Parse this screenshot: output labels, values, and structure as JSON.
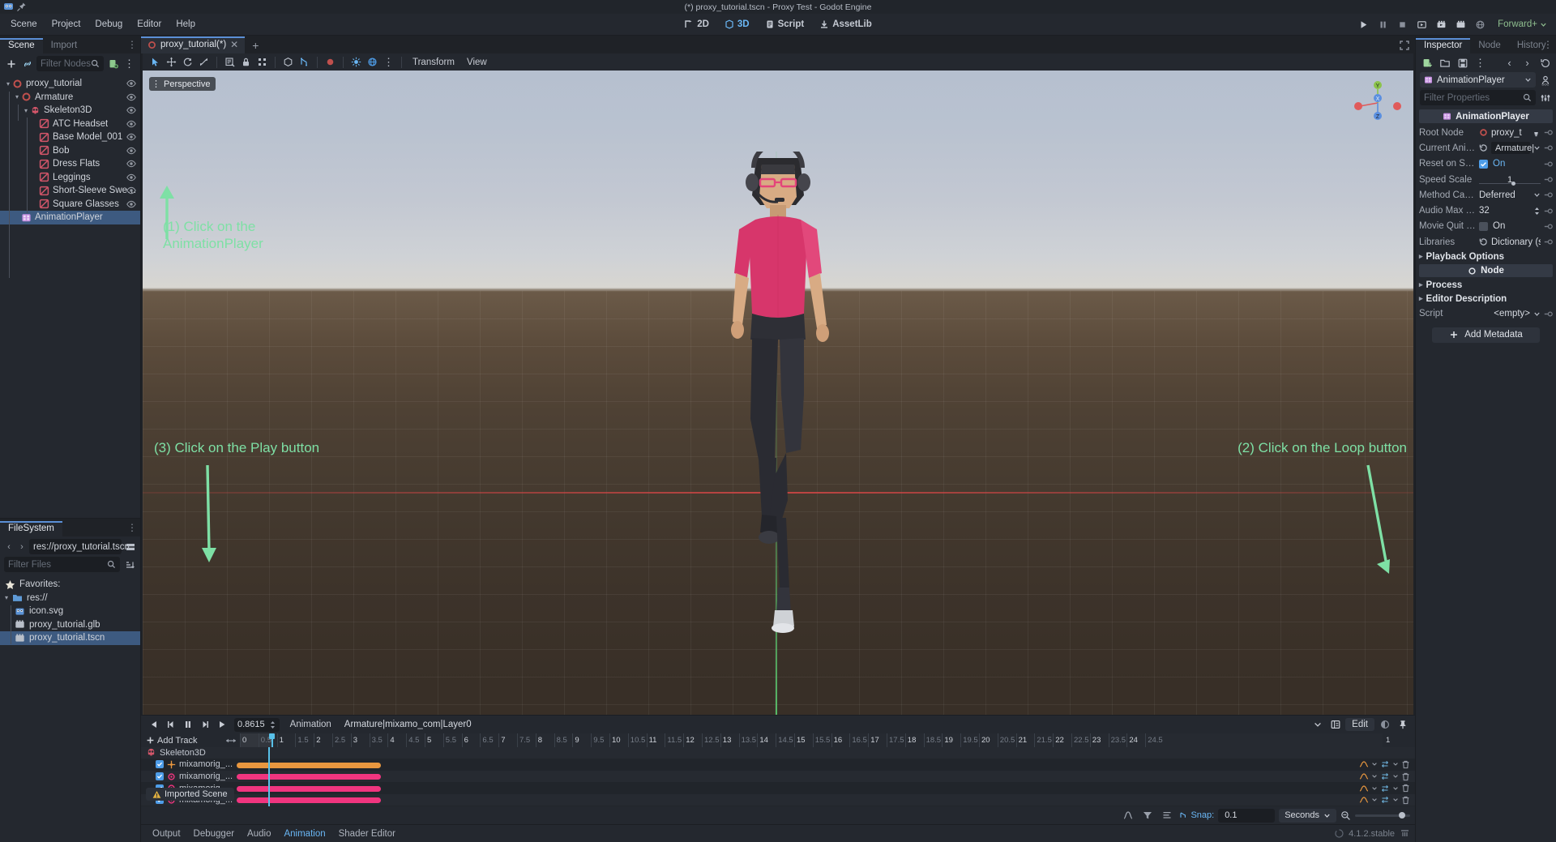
{
  "window": {
    "title": "(*) proxy_tutorial.tscn - Proxy Test - Godot Engine"
  },
  "menubar": {
    "items": [
      "Scene",
      "Project",
      "Debug",
      "Editor",
      "Help"
    ],
    "main_buttons": [
      {
        "label": "2D",
        "icon": "2d-icon",
        "active": false
      },
      {
        "label": "3D",
        "icon": "3d-icon",
        "active": true
      },
      {
        "label": "Script",
        "icon": "script-icon",
        "active": false
      },
      {
        "label": "AssetLib",
        "icon": "assetlib-icon",
        "active": false
      }
    ],
    "run_buttons": [
      "play-icon",
      "pause-icon",
      "stop-icon",
      "play-scene-icon",
      "movie-maker-icon",
      "play-custom-icon",
      "remote-debug-icon"
    ],
    "renderer": "Forward+"
  },
  "scene_panel": {
    "tabs": [
      {
        "label": "Scene",
        "active": true
      },
      {
        "label": "Import",
        "active": false
      }
    ],
    "filter_placeholder": "Filter Nodes",
    "toolbar_icons": [
      "add-node-icon",
      "link-node-icon",
      "search-icon",
      "attach-script-icon",
      "tree-options-icon"
    ],
    "tree": [
      {
        "label": "proxy_tutorial",
        "depth": 0,
        "icon": "node3d-icon",
        "expandable": true,
        "selected": false,
        "visibility": true
      },
      {
        "label": "Armature",
        "depth": 1,
        "icon": "node3d-icon",
        "expandable": true,
        "selected": false,
        "visibility": true
      },
      {
        "label": "Skeleton3D",
        "depth": 2,
        "icon": "skeleton3d-icon",
        "expandable": true,
        "selected": false,
        "visibility": true
      },
      {
        "label": "ATC Headset",
        "depth": 3,
        "icon": "meshinstance3d-icon",
        "expandable": false,
        "selected": false,
        "visibility": true
      },
      {
        "label": "Base Model_001",
        "depth": 3,
        "icon": "meshinstance3d-icon",
        "expandable": false,
        "selected": false,
        "visibility": true
      },
      {
        "label": "Bob",
        "depth": 3,
        "icon": "meshinstance3d-icon",
        "expandable": false,
        "selected": false,
        "visibility": true
      },
      {
        "label": "Dress Flats",
        "depth": 3,
        "icon": "meshinstance3d-icon",
        "expandable": false,
        "selected": false,
        "visibility": true
      },
      {
        "label": "Leggings",
        "depth": 3,
        "icon": "meshinstance3d-icon",
        "expandable": false,
        "selected": false,
        "visibility": true
      },
      {
        "label": "Short-Sleeve Sweatshirt",
        "depth": 3,
        "icon": "meshinstance3d-icon",
        "expandable": false,
        "selected": false,
        "visibility": true
      },
      {
        "label": "Square Glasses",
        "depth": 3,
        "icon": "meshinstance3d-icon",
        "expandable": false,
        "selected": false,
        "visibility": true
      },
      {
        "label": "AnimationPlayer",
        "depth": 1,
        "icon": "animationplayer-icon",
        "expandable": false,
        "selected": true,
        "visibility": false
      }
    ]
  },
  "filesystem_panel": {
    "tab": "FileSystem",
    "path": "res://proxy_tutorial.tscn",
    "filter_placeholder": "Filter Files",
    "entries": [
      {
        "label": "Favorites:",
        "depth": 0,
        "icon": "star-icon",
        "selected": false
      },
      {
        "label": "res://",
        "depth": 0,
        "icon": "folder-icon",
        "selected": false,
        "expandable": true
      },
      {
        "label": "icon.svg",
        "depth": 1,
        "icon": "image-icon",
        "selected": false
      },
      {
        "label": "proxy_tutorial.glb",
        "depth": 1,
        "icon": "scene-file-icon",
        "selected": false
      },
      {
        "label": "proxy_tutorial.tscn",
        "depth": 1,
        "icon": "scene-file-icon",
        "selected": true
      }
    ]
  },
  "scene_tabs": {
    "open": [
      {
        "label": "proxy_tutorial(*)",
        "active": true
      }
    ],
    "add_label": "+"
  },
  "viewport": {
    "toolbar_icons": [
      "select-mode-icon",
      "move-mode-icon",
      "rotate-mode-icon",
      "scale-mode-icon",
      "list-select-icon",
      "lock-icon",
      "group-icon",
      "snap-object-icon",
      "snap-icon",
      "light-preview-icon",
      "gizmo-visibility-icon",
      "preview-sun-env-icon",
      "view-options-icon"
    ],
    "menus": [
      "Transform",
      "View"
    ],
    "perspective_label": "Perspective",
    "gizmo_axes": [
      "X",
      "Y",
      "Z"
    ]
  },
  "annotations": [
    {
      "id": "anno-1",
      "text": "(1) Click on the\nAnimationPlayer",
      "color": "#7ee0a5"
    },
    {
      "id": "anno-2",
      "text": "(2) Click on the Loop button",
      "color": "#7ee0a5"
    },
    {
      "id": "anno-3",
      "text": "(3) Click on the Play button",
      "color": "#7ee0a5"
    }
  ],
  "animation_panel": {
    "transport_icons": [
      "play-backwards-icon",
      "prev-keyframe-icon",
      "stop-icon",
      "next-keyframe-icon",
      "play-icon"
    ],
    "time_value": "0.8615",
    "animation_menu": "Animation",
    "animation_name": "Armature|mixamo_com|Layer0",
    "edit_label": "Edit",
    "right_icons": [
      "chevron-down-icon",
      "animation-library-icon",
      "onion-skinning-icon",
      "loop-icon",
      "pin-icon"
    ],
    "add_track_label": "Add Track",
    "ruler_major": [
      "0",
      "1",
      "2",
      "3",
      "4",
      "5",
      "6",
      "7",
      "8",
      "9",
      "10",
      "11",
      "12",
      "13",
      "14",
      "15",
      "16",
      "17",
      "18",
      "19",
      "20",
      "21",
      "22",
      "23",
      "24"
    ],
    "ruler_minor": [
      "0.5",
      "1.5",
      "2.5",
      "3.5",
      "4.5",
      "5.5",
      "6.5",
      "7.5",
      "8.5",
      "9.5",
      "10.5",
      "11.5",
      "12.5",
      "13.5",
      "14.5",
      "15.5",
      "16.5",
      "17.5",
      "18.5",
      "19.5",
      "20.5",
      "21.5",
      "22.5",
      "23.5",
      "24.5"
    ],
    "end_marker": "1",
    "tracks_root": {
      "label": "Skeleton3D",
      "icon": "skeleton3d-icon"
    },
    "tracks": [
      {
        "label": "mixamorig_...",
        "icon": "position-track-icon",
        "enabled": true,
        "key_color": "#e8973f",
        "key_start_pct": 0.0,
        "key_end_pct": 3.9
      },
      {
        "label": "mixamorig_...",
        "icon": "rotation-track-icon",
        "enabled": true,
        "key_color": "#f0357f",
        "key_start_pct": 0.0,
        "key_end_pct": 3.9
      },
      {
        "label": "mixamorig_...",
        "icon": "rotation-track-icon",
        "enabled": true,
        "key_color": "#f0357f",
        "key_start_pct": 0.0,
        "key_end_pct": 3.9
      },
      {
        "label": "mixamorig_...",
        "icon": "rotation-track-icon",
        "enabled": true,
        "key_color": "#f0357f",
        "key_start_pct": 0.0,
        "key_end_pct": 3.9
      }
    ],
    "snap_label": "Snap:",
    "snap_value": "0.1",
    "snap_unit": "Seconds",
    "bottom_icons": [
      "bezier-editor-icon",
      "filter-icon",
      "track-list-icon"
    ]
  },
  "status_bar": {
    "imported_scene_label": "Imported Scene",
    "tabs": [
      {
        "label": "Output",
        "active": false
      },
      {
        "label": "Debugger",
        "active": false
      },
      {
        "label": "Audio",
        "active": false
      },
      {
        "label": "Animation",
        "active": true
      },
      {
        "label": "Shader Editor",
        "active": false
      }
    ],
    "version": "4.1.2.stable"
  },
  "inspector": {
    "tabs": [
      {
        "label": "Inspector",
        "active": true
      },
      {
        "label": "Node",
        "active": false
      },
      {
        "label": "History",
        "active": false
      }
    ],
    "toolbar_icons": [
      "open-resource-icon",
      "folder-icon",
      "save-icon",
      "extra-options-icon",
      "back-icon",
      "forward-icon",
      "history-icon"
    ],
    "resource_name": "AnimationPlayer",
    "filter_placeholder": "Filter Properties",
    "object_header": "AnimationPlayer",
    "properties": [
      {
        "key": "Root Node",
        "value": "proxy_t",
        "type": "node-path",
        "revert": true
      },
      {
        "key": "Current Anim...",
        "value": "Armature|",
        "type": "dropdown",
        "revert": true,
        "has_reset": true
      },
      {
        "key": "Reset on Save",
        "value": "On",
        "type": "checkbox",
        "checked": true,
        "revert": true
      },
      {
        "key": "Speed Scale",
        "value": "1",
        "type": "slider",
        "revert": true
      },
      {
        "key": "Method Call Mo...",
        "value": "Deferred",
        "type": "dropdown",
        "revert": true
      },
      {
        "key": "Audio Max Poly...",
        "value": "32",
        "type": "spinbox",
        "revert": true
      },
      {
        "key": "Movie Quit on F...",
        "value": "On",
        "type": "checkbox",
        "checked": false,
        "revert": true
      },
      {
        "key": "Libraries",
        "value": "Dictionary (siz",
        "type": "resource",
        "revert": true,
        "has_reset": true
      }
    ],
    "sections": [
      "Playback Options",
      "Process",
      "Editor Description"
    ],
    "node_category": "Node",
    "script_key": "Script",
    "script_value": "<empty>",
    "add_metadata_label": "Add Metadata"
  },
  "colors": {
    "accent": "#6ab7f5",
    "selection": "#3d5a80",
    "panel": "#24282f",
    "dark": "#1b1e23",
    "annotation_green": "#7ee0a5",
    "key_orange": "#e8973f",
    "key_pink": "#f0357f",
    "playhead": "#58c0e8"
  }
}
